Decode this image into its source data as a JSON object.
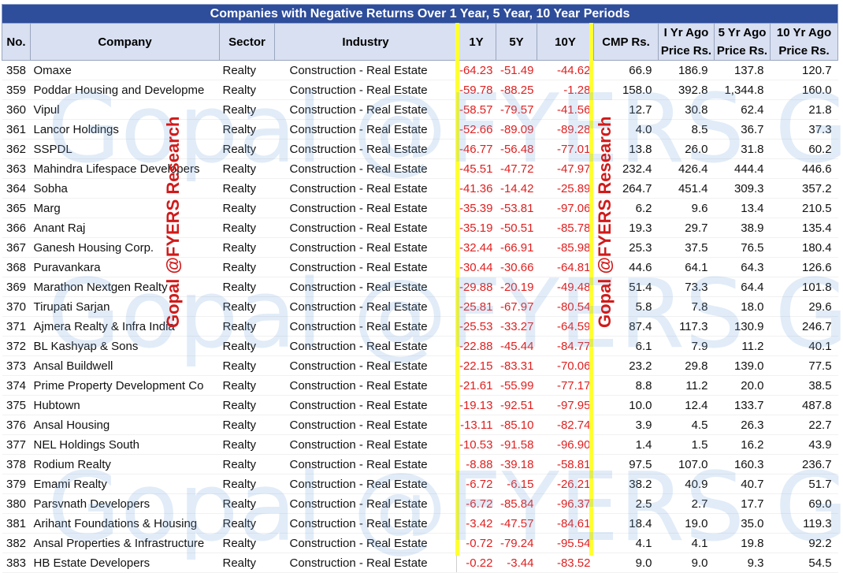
{
  "title": "Companies with Negative Returns Over 1 Year, 5 Year, 10 Year Periods",
  "columns": {
    "no": "No.",
    "company": "Company",
    "sector": "Sector",
    "industry": "Industry",
    "y1": "1Y",
    "y5": "5Y",
    "y10": "10Y",
    "cmp": "CMP Rs.",
    "p1_line1": "I Yr Ago",
    "p1_line2": "Price Rs.",
    "p5_line1": "5 Yr Ago",
    "p5_line2": "Price Rs.",
    "p10_line1": "10 Yr Ago",
    "p10_line2": "Price Rs."
  },
  "watermark": {
    "text": "Gopal @FYERS Gopal",
    "stamp": "Gopal @FYERS Research"
  },
  "colors": {
    "title_bg": "#2e4d9a",
    "header_bg": "#d8e0f1",
    "negative": "#e02020",
    "highlight_line": "#ffff33",
    "stamp": "#d11a1a"
  },
  "rows": [
    {
      "no": "358",
      "company": "Omaxe",
      "sector": "Realty",
      "industry": "Construction - Real Estate",
      "y1": "-64.23",
      "y5": "-51.49",
      "y10": "-44.62",
      "cmp": "66.9",
      "p1": "186.9",
      "p5": "137.8",
      "p10": "120.7"
    },
    {
      "no": "359",
      "company": "Poddar Housing and Developme",
      "sector": "Realty",
      "industry": "Construction - Real Estate",
      "y1": "-59.78",
      "y5": "-88.25",
      "y10": "-1.28",
      "cmp": "158.0",
      "p1": "392.8",
      "p5": "1,344.8",
      "p10": "160.0"
    },
    {
      "no": "360",
      "company": "Vipul",
      "sector": "Realty",
      "industry": "Construction - Real Estate",
      "y1": "-58.57",
      "y5": "-79.57",
      "y10": "-41.56",
      "cmp": "12.7",
      "p1": "30.8",
      "p5": "62.4",
      "p10": "21.8"
    },
    {
      "no": "361",
      "company": "Lancor Holdings",
      "sector": "Realty",
      "industry": "Construction - Real Estate",
      "y1": "-52.66",
      "y5": "-89.09",
      "y10": "-89.28",
      "cmp": "4.0",
      "p1": "8.5",
      "p5": "36.7",
      "p10": "37.3"
    },
    {
      "no": "362",
      "company": "SSPDL",
      "sector": "Realty",
      "industry": "Construction - Real Estate",
      "y1": "-46.77",
      "y5": "-56.48",
      "y10": "-77.01",
      "cmp": "13.8",
      "p1": "26.0",
      "p5": "31.8",
      "p10": "60.2"
    },
    {
      "no": "363",
      "company": "Mahindra Lifespace Developers",
      "sector": "Realty",
      "industry": "Construction - Real Estate",
      "y1": "-45.51",
      "y5": "-47.72",
      "y10": "-47.97",
      "cmp": "232.4",
      "p1": "426.4",
      "p5": "444.4",
      "p10": "446.6"
    },
    {
      "no": "364",
      "company": "Sobha",
      "sector": "Realty",
      "industry": "Construction - Real Estate",
      "y1": "-41.36",
      "y5": "-14.42",
      "y10": "-25.89",
      "cmp": "264.7",
      "p1": "451.4",
      "p5": "309.3",
      "p10": "357.2"
    },
    {
      "no": "365",
      "company": "Marg",
      "sector": "Realty",
      "industry": "Construction - Real Estate",
      "y1": "-35.39",
      "y5": "-53.81",
      "y10": "-97.06",
      "cmp": "6.2",
      "p1": "9.6",
      "p5": "13.4",
      "p10": "210.5"
    },
    {
      "no": "366",
      "company": "Anant Raj",
      "sector": "Realty",
      "industry": "Construction - Real Estate",
      "y1": "-35.19",
      "y5": "-50.51",
      "y10": "-85.78",
      "cmp": "19.3",
      "p1": "29.7",
      "p5": "38.9",
      "p10": "135.4"
    },
    {
      "no": "367",
      "company": "Ganesh Housing Corp.",
      "sector": "Realty",
      "industry": "Construction - Real Estate",
      "y1": "-32.44",
      "y5": "-66.91",
      "y10": "-85.98",
      "cmp": "25.3",
      "p1": "37.5",
      "p5": "76.5",
      "p10": "180.4"
    },
    {
      "no": "368",
      "company": "Puravankara",
      "sector": "Realty",
      "industry": "Construction - Real Estate",
      "y1": "-30.44",
      "y5": "-30.66",
      "y10": "-64.81",
      "cmp": "44.6",
      "p1": "64.1",
      "p5": "64.3",
      "p10": "126.6"
    },
    {
      "no": "369",
      "company": "Marathon Nextgen Realty",
      "sector": "Realty",
      "industry": "Construction - Real Estate",
      "y1": "-29.88",
      "y5": "-20.19",
      "y10": "-49.48",
      "cmp": "51.4",
      "p1": "73.3",
      "p5": "64.4",
      "p10": "101.8"
    },
    {
      "no": "370",
      "company": "Tirupati Sarjan",
      "sector": "Realty",
      "industry": "Construction - Real Estate",
      "y1": "-25.81",
      "y5": "-67.97",
      "y10": "-80.54",
      "cmp": "5.8",
      "p1": "7.8",
      "p5": "18.0",
      "p10": "29.6"
    },
    {
      "no": "371",
      "company": "Ajmera Realty & Infra India",
      "sector": "Realty",
      "industry": "Construction - Real Estate",
      "y1": "-25.53",
      "y5": "-33.27",
      "y10": "-64.59",
      "cmp": "87.4",
      "p1": "117.3",
      "p5": "130.9",
      "p10": "246.7"
    },
    {
      "no": "372",
      "company": "BL Kashyap & Sons",
      "sector": "Realty",
      "industry": "Construction - Real Estate",
      "y1": "-22.88",
      "y5": "-45.44",
      "y10": "-84.77",
      "cmp": "6.1",
      "p1": "7.9",
      "p5": "11.2",
      "p10": "40.1"
    },
    {
      "no": "373",
      "company": "Ansal Buildwell",
      "sector": "Realty",
      "industry": "Construction - Real Estate",
      "y1": "-22.15",
      "y5": "-83.31",
      "y10": "-70.06",
      "cmp": "23.2",
      "p1": "29.8",
      "p5": "139.0",
      "p10": "77.5"
    },
    {
      "no": "374",
      "company": "Prime Property Development Co",
      "sector": "Realty",
      "industry": "Construction - Real Estate",
      "y1": "-21.61",
      "y5": "-55.99",
      "y10": "-77.17",
      "cmp": "8.8",
      "p1": "11.2",
      "p5": "20.0",
      "p10": "38.5"
    },
    {
      "no": "375",
      "company": "Hubtown",
      "sector": "Realty",
      "industry": "Construction - Real Estate",
      "y1": "-19.13",
      "y5": "-92.51",
      "y10": "-97.95",
      "cmp": "10.0",
      "p1": "12.4",
      "p5": "133.7",
      "p10": "487.8"
    },
    {
      "no": "376",
      "company": "Ansal Housing",
      "sector": "Realty",
      "industry": "Construction - Real Estate",
      "y1": "-13.11",
      "y5": "-85.10",
      "y10": "-82.74",
      "cmp": "3.9",
      "p1": "4.5",
      "p5": "26.3",
      "p10": "22.7"
    },
    {
      "no": "377",
      "company": "NEL Holdings South",
      "sector": "Realty",
      "industry": "Construction - Real Estate",
      "y1": "-10.53",
      "y5": "-91.58",
      "y10": "-96.90",
      "cmp": "1.4",
      "p1": "1.5",
      "p5": "16.2",
      "p10": "43.9"
    },
    {
      "no": "378",
      "company": "Rodium Realty",
      "sector": "Realty",
      "industry": "Construction - Real Estate",
      "y1": "-8.88",
      "y5": "-39.18",
      "y10": "-58.81",
      "cmp": "97.5",
      "p1": "107.0",
      "p5": "160.3",
      "p10": "236.7"
    },
    {
      "no": "379",
      "company": "Emami Realty",
      "sector": "Realty",
      "industry": "Construction - Real Estate",
      "y1": "-6.72",
      "y5": "-6.15",
      "y10": "-26.21",
      "cmp": "38.2",
      "p1": "40.9",
      "p5": "40.7",
      "p10": "51.7"
    },
    {
      "no": "380",
      "company": "Parsvnath Developers",
      "sector": "Realty",
      "industry": "Construction - Real Estate",
      "y1": "-6.72",
      "y5": "-85.84",
      "y10": "-96.37",
      "cmp": "2.5",
      "p1": "2.7",
      "p5": "17.7",
      "p10": "69.0"
    },
    {
      "no": "381",
      "company": "Arihant Foundations & Housing",
      "sector": "Realty",
      "industry": "Construction - Real Estate",
      "y1": "-3.42",
      "y5": "-47.57",
      "y10": "-84.61",
      "cmp": "18.4",
      "p1": "19.0",
      "p5": "35.0",
      "p10": "119.3"
    },
    {
      "no": "382",
      "company": "Ansal Properties & Infrastructure",
      "sector": "Realty",
      "industry": "Construction - Real Estate",
      "y1": "-0.72",
      "y5": "-79.24",
      "y10": "-95.54",
      "cmp": "4.1",
      "p1": "4.1",
      "p5": "19.8",
      "p10": "92.2"
    },
    {
      "no": "383",
      "company": "HB Estate Developers",
      "sector": "Realty",
      "industry": "Construction - Real Estate",
      "y1": "-0.22",
      "y5": "-3.44",
      "y10": "-83.52",
      "cmp": "9.0",
      "p1": "9.0",
      "p5": "9.3",
      "p10": "54.5"
    }
  ]
}
